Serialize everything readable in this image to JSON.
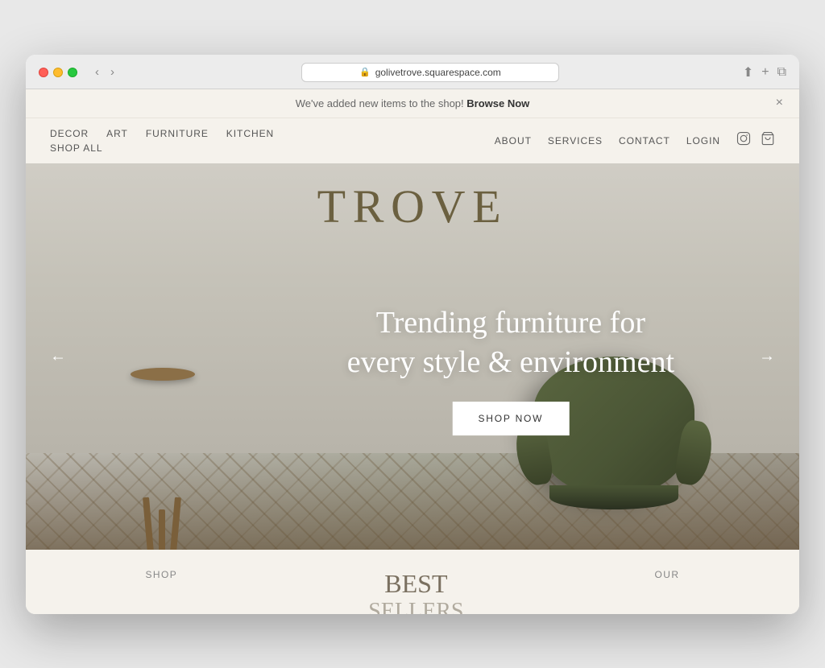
{
  "browser": {
    "url": "golivetrove.squarespace.com",
    "back_btn": "‹",
    "forward_btn": "›"
  },
  "notification": {
    "text": "We've added new items to the shop!",
    "link_text": "Browse Now",
    "close_label": "×"
  },
  "nav": {
    "left_row1": [
      "DECOR",
      "ART",
      "FURNITURE",
      "KITCHEN"
    ],
    "left_row2": [
      "SHOP ALL"
    ],
    "right_items": [
      "ABOUT",
      "SERVICES",
      "CONTACT",
      "LOGIN"
    ]
  },
  "hero": {
    "site_title": "TROVE",
    "heading_line1": "Trending furniture for",
    "heading_line2": "every style & environment",
    "cta_label": "SHOP NOW",
    "arrow_left": "←",
    "arrow_right": "→"
  },
  "below_fold": {
    "left_label": "SHOP",
    "center_title": "BEST",
    "center_subtitle": "SELLERS",
    "right_label": "OUR"
  }
}
